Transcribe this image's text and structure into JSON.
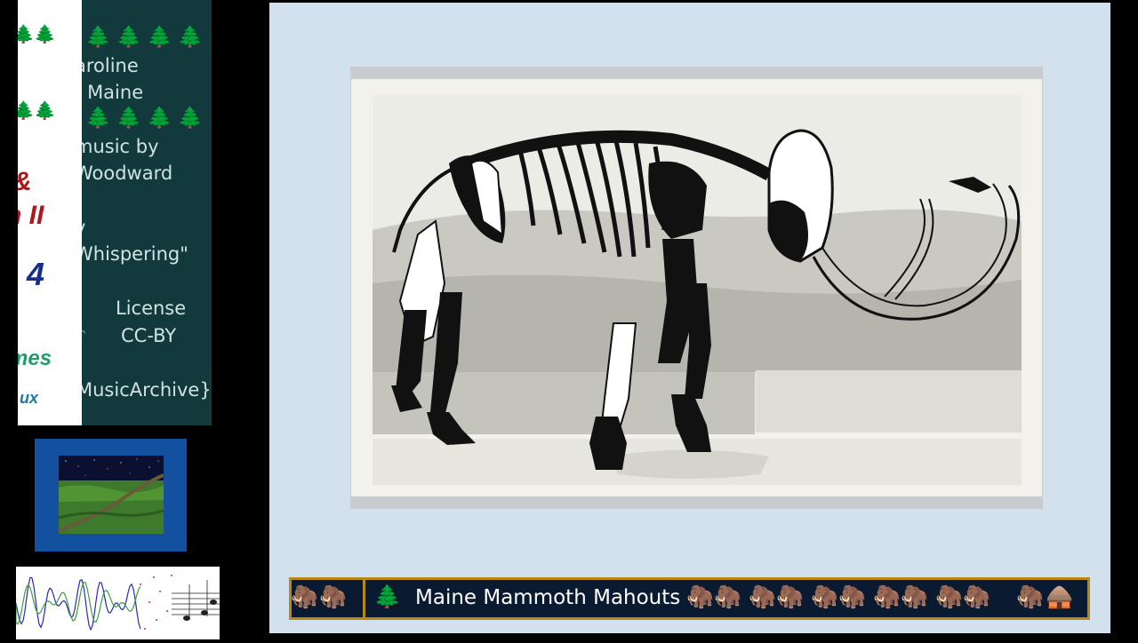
{
  "credits": {
    "lines": [
      "aroline",
      "f Maine",
      "music by",
      "Woodward",
      "y",
      "Whispering\"",
      "License",
      "CC-BY",
      "MusicArchive}"
    ]
  },
  "left_strip": {
    "text_amp": "&",
    "text_ii": "n II",
    "text_4": "4",
    "text_green": "mes",
    "text_ux": "ux"
  },
  "banner": {
    "title": "Maine Mammoth Mahouts"
  },
  "icons": {
    "tree": "🌲",
    "mammoth": "🦣",
    "music_note": "♪",
    "hut": "🛖"
  }
}
